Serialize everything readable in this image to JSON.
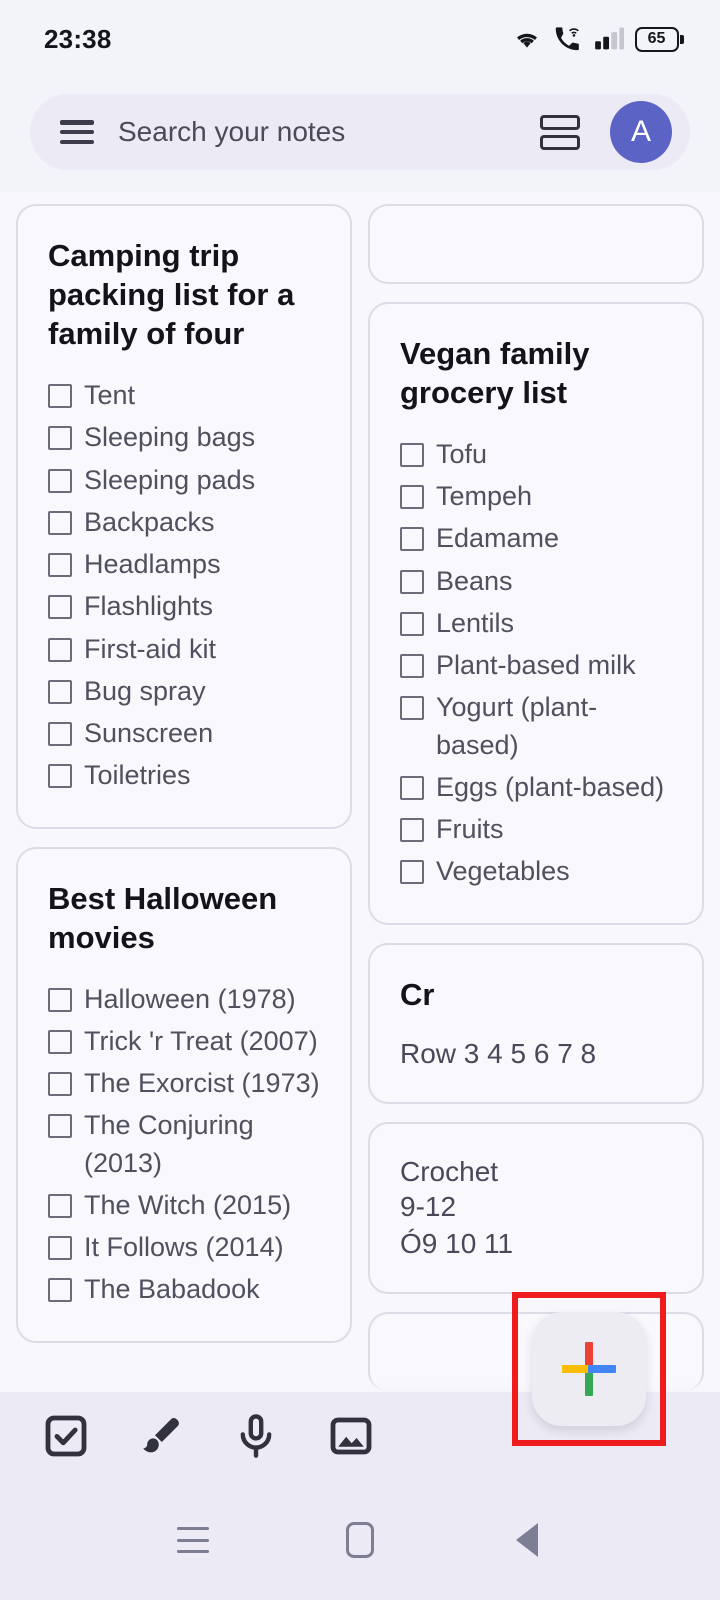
{
  "status_bar": {
    "time": "23:38",
    "battery_percent": "65",
    "icons": [
      "wifi-icon",
      "call-over-wifi-icon",
      "cellular-signal-icon",
      "battery-icon"
    ]
  },
  "search": {
    "placeholder": "Search your notes",
    "menu_icon": "hamburger-menu-icon",
    "view_toggle_icon": "list-view-toggle-icon",
    "avatar_initial": "A",
    "avatar_color": "#5b63c4"
  },
  "notes": {
    "left_column": [
      {
        "id": "camping-trip",
        "title": "Camping trip packing list for a family of four",
        "type": "checklist",
        "items": [
          "Tent",
          "Sleeping bags",
          "Sleeping pads",
          "Backpacks",
          "Headlamps",
          "Flashlights",
          "First-aid kit",
          "Bug spray",
          "Sunscreen",
          "Toiletries"
        ]
      },
      {
        "id": "halloween-movies",
        "title": "Best Halloween movies",
        "type": "checklist",
        "items": [
          "Halloween (1978)",
          "Trick 'r Treat (2007)",
          "The Exorcist (1973)",
          "The Conjuring (2013)",
          "The Witch (2015)",
          "It Follows (2014)",
          "The Babadook"
        ]
      }
    ],
    "right_column": [
      {
        "id": "empty-note",
        "title": "",
        "type": "empty",
        "items": []
      },
      {
        "id": "vegan-grocery",
        "title": "Vegan family grocery list",
        "type": "checklist",
        "items": [
          "Tofu",
          "Tempeh",
          "Edamame",
          "Beans",
          "Lentils",
          "Plant-based milk",
          "Yogurt (plant-based)",
          "Eggs (plant-based)",
          "Fruits",
          "Vegetables"
        ]
      },
      {
        "id": "cr-note",
        "title": "Cr",
        "type": "text",
        "body": "Row 3 4 5 6 7 8"
      },
      {
        "id": "crochet-note",
        "title": "Crochet",
        "type": "plain",
        "body": "9-12\nÓ9 10 11"
      }
    ]
  },
  "fab": {
    "label": "create-note",
    "icon": "google-plus-icon",
    "highlight_color": "#ee1c1c",
    "plus_colors": {
      "top": "#ea4335",
      "right": "#4285f4",
      "bottom": "#34a853",
      "left": "#fbbc05"
    }
  },
  "bottom_toolbar": {
    "buttons": [
      {
        "name": "new-list-button",
        "icon": "checkbox-icon"
      },
      {
        "name": "new-drawing-button",
        "icon": "brush-icon"
      },
      {
        "name": "new-voice-note-button",
        "icon": "microphone-icon"
      },
      {
        "name": "new-image-note-button",
        "icon": "image-icon"
      }
    ]
  },
  "nav_bar": {
    "buttons": [
      {
        "name": "recents-button",
        "icon": "recents-icon"
      },
      {
        "name": "home-button",
        "icon": "home-icon"
      },
      {
        "name": "back-button",
        "icon": "back-triangle-icon"
      }
    ]
  }
}
